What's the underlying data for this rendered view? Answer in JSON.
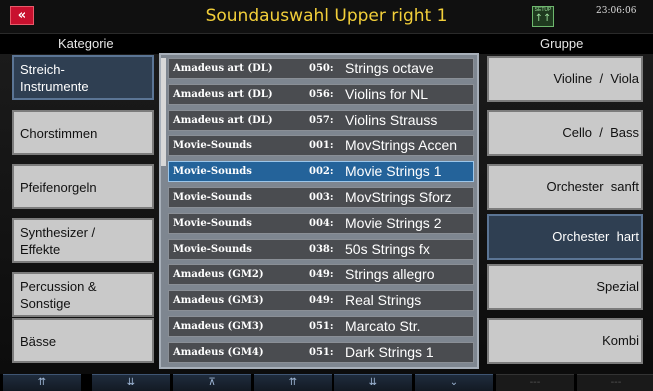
{
  "titlebar": {
    "back_icon": "«",
    "title": "Soundauswahl Upper right 1",
    "setup_label": "SETUP",
    "setup_icon": "↑↑",
    "clock": "23:06:06"
  },
  "headers": {
    "left": "Kategorie",
    "right": "Gruppe"
  },
  "categories": [
    {
      "label": "Streich-\nInstrumente",
      "active": true
    },
    {
      "label": "Chorstimmen"
    },
    {
      "label": "Pfeifenorgeln"
    },
    {
      "label": "Synthesizer /\nEffekte"
    },
    {
      "label": "Percussion &\nSonstige"
    },
    {
      "label": "Bässe"
    }
  ],
  "sounds": [
    {
      "bank": "Amadeus art (DL)",
      "num": "050:",
      "name": "Strings octave"
    },
    {
      "bank": "Amadeus art (DL)",
      "num": "056:",
      "name": "Violins for NL"
    },
    {
      "bank": "Amadeus art (DL)",
      "num": "057:",
      "name": "Violins Strauss"
    },
    {
      "bank": "Movie-Sounds",
      "num": "001:",
      "name": "MovStrings Accen"
    },
    {
      "bank": "Movie-Sounds",
      "num": "002:",
      "name": "Movie Strings 1",
      "selected": true
    },
    {
      "bank": "Movie-Sounds",
      "num": "003:",
      "name": "MovStrings Sforz"
    },
    {
      "bank": "Movie-Sounds",
      "num": "004:",
      "name": "Movie Strings 2"
    },
    {
      "bank": "Movie-Sounds",
      "num": "038:",
      "name": "50s Strings   fx"
    },
    {
      "bank": "Amadeus (GM2)",
      "num": "049:",
      "name": "Strings allegro"
    },
    {
      "bank": "Amadeus (GM3)",
      "num": "049:",
      "name": "Real Strings"
    },
    {
      "bank": "Amadeus (GM3)",
      "num": "051:",
      "name": "Marcato Str."
    },
    {
      "bank": "Amadeus (GM4)",
      "num": "051:",
      "name": "Dark Strings 1"
    }
  ],
  "groups": [
    {
      "label": "Violine  /  Viola"
    },
    {
      "label": "Cello  /  Bass"
    },
    {
      "label": "Orchester  sanft"
    },
    {
      "label": "Orchester  hart",
      "active": true
    },
    {
      "label": "Spezial"
    },
    {
      "label": "Kombi"
    }
  ],
  "bottom_nav": [
    {
      "icon": "⇈",
      "name": "page-up-icon"
    },
    {
      "icon": "⇊",
      "name": "page-down-icon"
    },
    {
      "icon": "⊼",
      "name": "to-top-icon"
    },
    {
      "icon": "⇈",
      "name": "scroll-up-icon"
    },
    {
      "icon": "⇊",
      "name": "scroll-down-icon"
    },
    {
      "icon": "⌄",
      "name": "chevron-down-icon"
    },
    {
      "icon": "---",
      "name": "empty-slot",
      "inactive": true
    },
    {
      "icon": "---",
      "name": "empty-slot-2",
      "inactive": true
    }
  ]
}
